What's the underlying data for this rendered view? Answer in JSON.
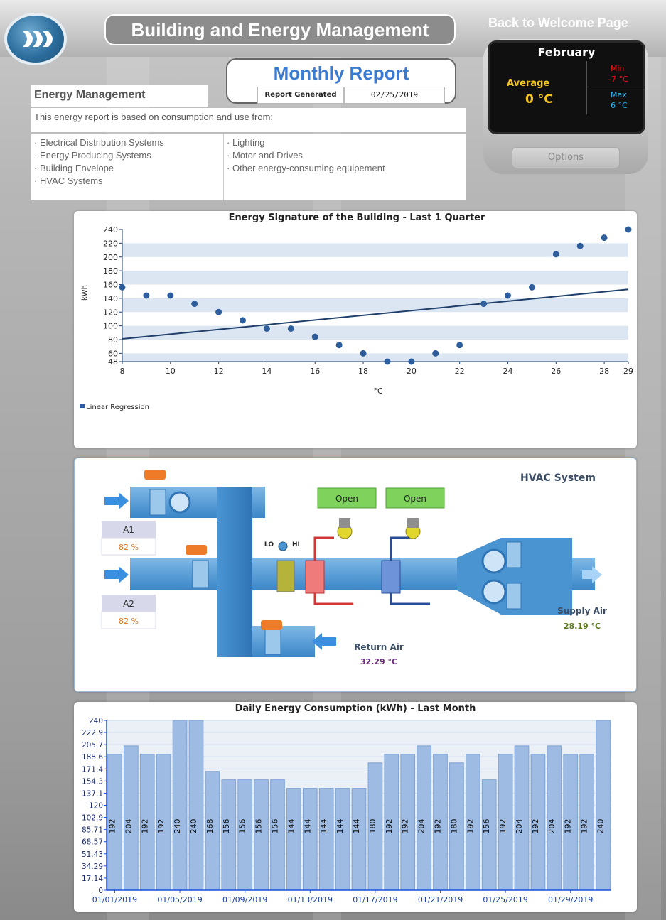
{
  "header": {
    "app_title": "Building and Energy Management",
    "back_link": "Back to Welcome Page"
  },
  "weather": {
    "month": "February",
    "average_label": "Average",
    "average_value": "0 °C",
    "min_label": "Min",
    "min_value": "-7 °C",
    "max_label": "Max",
    "max_value": "6 °C",
    "options_label": "Options"
  },
  "report": {
    "title": "Monthly Report",
    "generated_label": "Report Generated",
    "generated_date": "02/25/2019"
  },
  "energy_management": {
    "title": "Energy Management",
    "description": "This energy report is based on consumption and use from:",
    "sources_left": [
      "Electrical Distribution Systems",
      "Energy Producing Systems",
      "Building Envelope",
      "HVAC Systems"
    ],
    "sources_right": [
      "Lighting",
      "Motor and Drives",
      "Other energy-consuming equipement"
    ]
  },
  "hvac": {
    "title": "HVAC System",
    "valve1_label": "Open",
    "valve2_label": "Open",
    "a1_label": "A1",
    "a1_value": "82 %",
    "a2_label": "A2",
    "a2_value": "82 %",
    "lo_label": "LO",
    "hi_label": "HI",
    "return_air_label": "Return Air",
    "return_air_value": "32.29 °C",
    "supply_air_label": "Supply Air",
    "supply_air_value": "28.19 °C"
  },
  "chart_data": [
    {
      "type": "scatter",
      "title": "Energy Signature of the Building - Last 1 Quarter",
      "xlabel": "°C",
      "ylabel": "kWh",
      "xlim": [
        8,
        29
      ],
      "ylim": [
        48,
        240
      ],
      "x_ticks": [
        8,
        10,
        12,
        14,
        16,
        18,
        20,
        22,
        24,
        26,
        28,
        29
      ],
      "y_ticks": [
        48,
        60,
        80,
        100,
        120,
        140,
        160,
        180,
        200,
        220,
        240
      ],
      "points": [
        [
          8,
          156
        ],
        [
          9,
          144
        ],
        [
          10,
          144
        ],
        [
          11,
          132
        ],
        [
          12,
          120
        ],
        [
          13,
          108
        ],
        [
          14,
          96
        ],
        [
          15,
          96
        ],
        [
          16,
          84
        ],
        [
          17,
          72
        ],
        [
          18,
          60
        ],
        [
          19,
          48
        ],
        [
          20,
          48
        ],
        [
          21,
          60
        ],
        [
          22,
          72
        ],
        [
          23,
          132
        ],
        [
          24,
          144
        ],
        [
          25,
          156
        ],
        [
          26,
          204
        ],
        [
          27,
          216
        ],
        [
          28,
          228
        ],
        [
          29,
          240
        ]
      ],
      "regression": {
        "name": "Linear Regression",
        "x": [
          8,
          29
        ],
        "y": [
          81,
          153
        ]
      },
      "grid": true,
      "legend": "bottom-left",
      "colors": {
        "points": "#2e5d9c",
        "band": "#dce6f2",
        "line": "#1f3f6b"
      }
    },
    {
      "type": "bar",
      "title": "Daily Energy Consumption (kWh) - Last Month",
      "categories": [
        "01/01/2019",
        "01/02/2019",
        "01/03/2019",
        "01/04/2019",
        "01/05/2019",
        "01/06/2019",
        "01/07/2019",
        "01/08/2019",
        "01/09/2019",
        "01/10/2019",
        "01/11/2019",
        "01/12/2019",
        "01/13/2019",
        "01/14/2019",
        "01/15/2019",
        "01/16/2019",
        "01/17/2019",
        "01/18/2019",
        "01/19/2019",
        "01/20/2019",
        "01/21/2019",
        "01/22/2019",
        "01/23/2019",
        "01/24/2019",
        "01/25/2019",
        "01/26/2019",
        "01/27/2019",
        "01/28/2019",
        "01/29/2019",
        "01/30/2019",
        "01/31/2019"
      ],
      "values": [
        192,
        204,
        192,
        192,
        240,
        240,
        168,
        156,
        156,
        156,
        156,
        144,
        144,
        144,
        144,
        144,
        180,
        192,
        192,
        204,
        192,
        180,
        192,
        156,
        192,
        204,
        192,
        204,
        192,
        192,
        240
      ],
      "x_tick_labels": [
        "01/01/2019",
        "01/05/2019",
        "01/09/2019",
        "01/13/2019",
        "01/17/2019",
        "01/21/2019",
        "01/25/2019",
        "01/29/2019"
      ],
      "y_ticks": [
        "0",
        "17.14",
        "34.29",
        "51.43",
        "68.57",
        "85.71",
        "102.9",
        "120",
        "137.1",
        "154.3",
        "171.4",
        "188.6",
        "205.7",
        "222.9",
        "240"
      ],
      "ylim": [
        0,
        240
      ],
      "grid": true,
      "colors": {
        "bar": "#9dbbe3",
        "bar_edge": "#7ea3d6",
        "axis": "#1d4fd8"
      }
    }
  ]
}
